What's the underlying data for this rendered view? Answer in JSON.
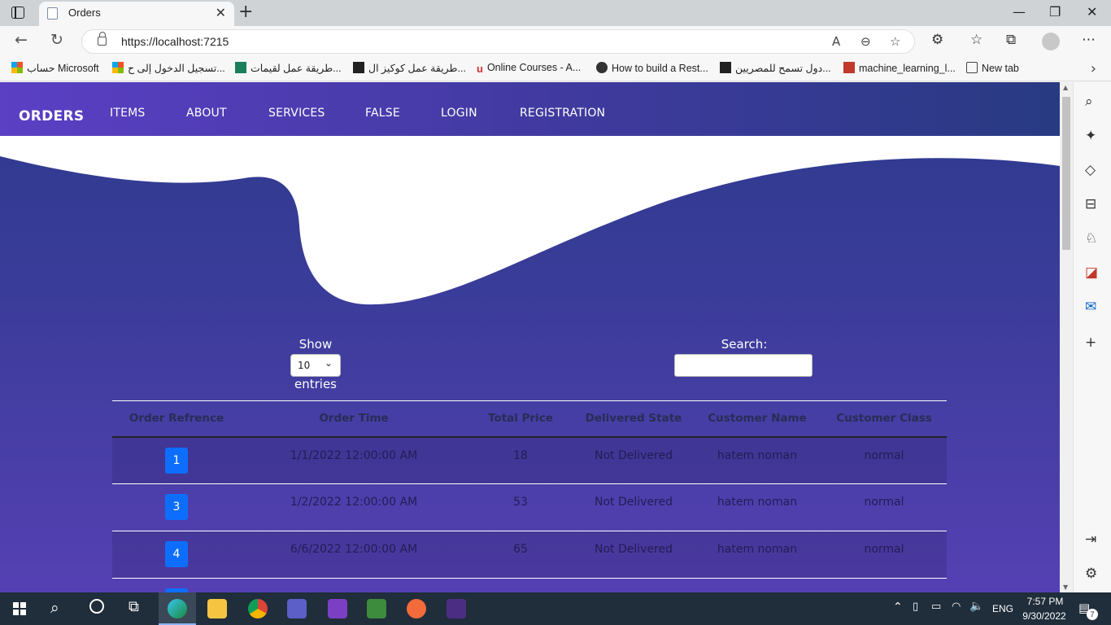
{
  "browser": {
    "tab_title": "Orders",
    "url": "https://localhost:7215",
    "bookmarks": [
      "حساب Microsoft",
      "تسجيل الدخول إلى ح...",
      "طريقة عمل لقيمات...",
      "طريقة عمل كوكيز ال...",
      "Online Courses - A...",
      "How to build a Rest...",
      "دول تسمح للمصريين...",
      "machine_learning_l...",
      "New tab"
    ]
  },
  "nav": {
    "brand": "ORDERS",
    "links": [
      "ITEMS",
      "ABOUT",
      "SERVICES",
      "FALSE",
      "LOGIN",
      "REGISTRATION"
    ]
  },
  "controls": {
    "show_label": "Show",
    "entries_value": "10",
    "entries_label": "entries",
    "search_label": "Search:"
  },
  "table": {
    "headers": [
      "Order Refrence",
      "Order Time",
      "Total Price",
      "Delivered State",
      "Customer Name",
      "Customer Class"
    ],
    "rows": [
      {
        "ref": "1",
        "time": "1/1/2022 12:00:00 AM",
        "price": "18",
        "state": "Not Delivered",
        "customer": "hatem noman",
        "class": "normal"
      },
      {
        "ref": "3",
        "time": "1/2/2022 12:00:00 AM",
        "price": "53",
        "state": "Not Delivered",
        "customer": "hatem noman",
        "class": "normal"
      },
      {
        "ref": "4",
        "time": "6/6/2022 12:00:00 AM",
        "price": "65",
        "state": "Not Delivered",
        "customer": "hatem noman",
        "class": "normal"
      }
    ]
  },
  "taskbar": {
    "language": "ENG",
    "time": "7:57 PM",
    "date": "9/30/2022",
    "notification_count": "7"
  }
}
